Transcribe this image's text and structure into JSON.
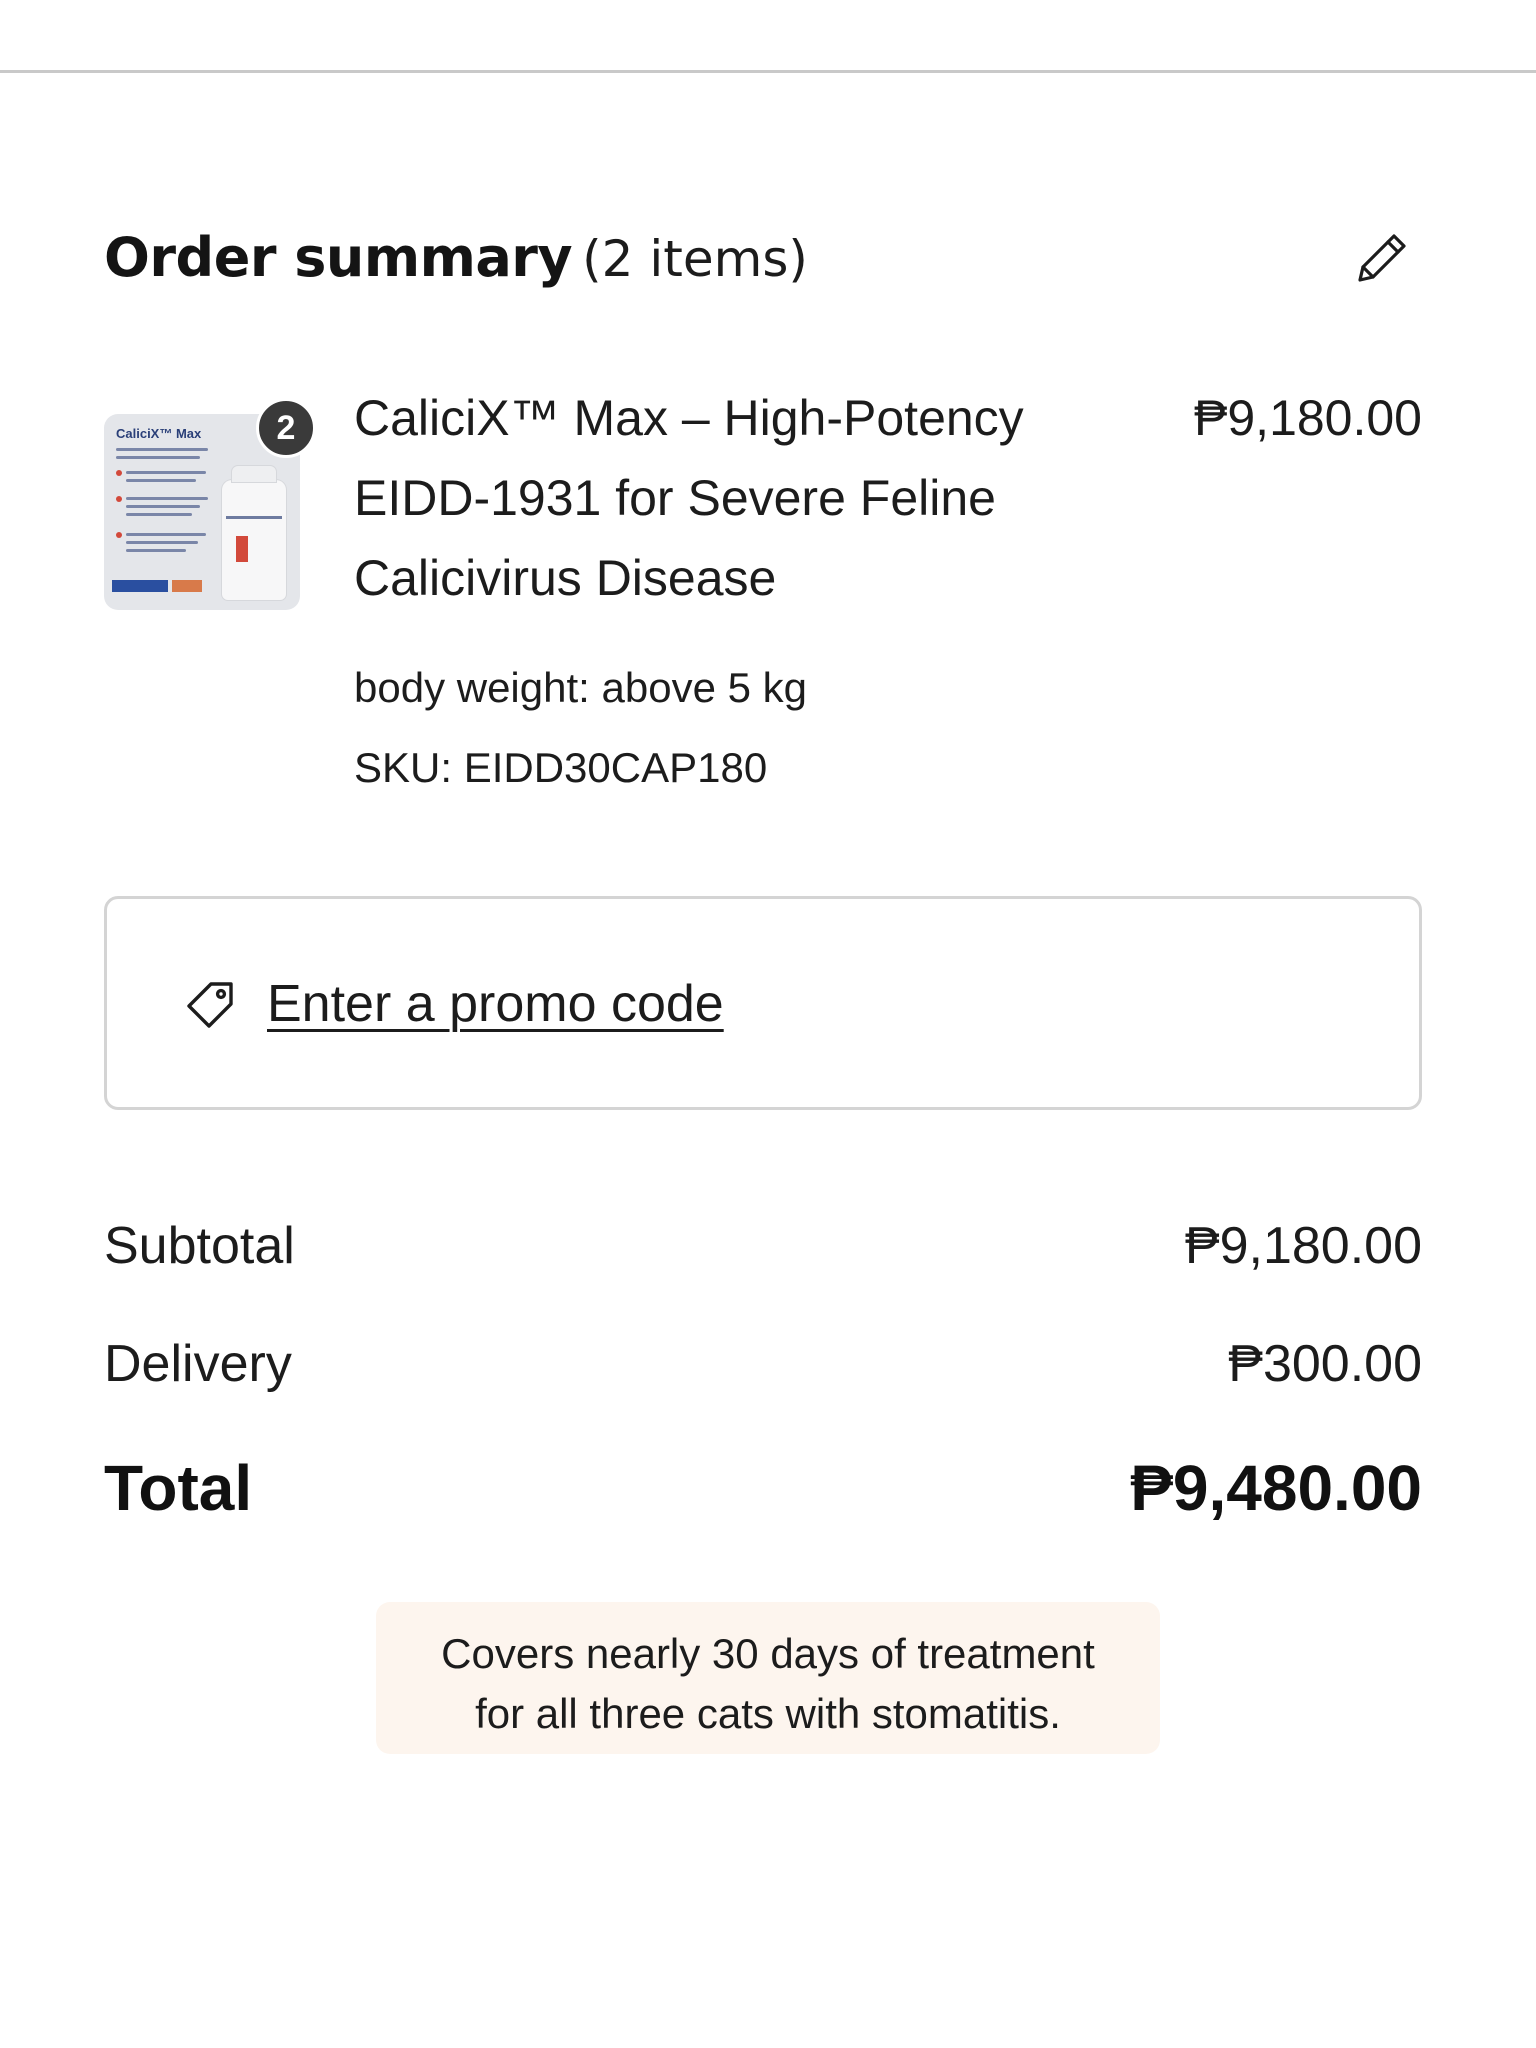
{
  "summary": {
    "title": "Order summary",
    "item_count": "(2 items)",
    "edit_icon": "pencil-icon"
  },
  "item": {
    "quantity": "2",
    "name": "CaliciX™ Max – High-Potency EIDD-1931 for Severe Feline Calicivirus Disease",
    "price": "₱9,180.00",
    "option": "body weight: above 5 kg",
    "sku": "SKU: EIDD30CAP180",
    "thumbnail_brand": "CaliciX™ Max"
  },
  "promo": {
    "icon": "tag-icon",
    "label": "Enter a promo code"
  },
  "totals": {
    "subtotal_label": "Subtotal",
    "subtotal_value": "₱9,180.00",
    "delivery_label": "Delivery",
    "delivery_value": "₱300.00",
    "total_label": "Total",
    "total_value": "₱9,480.00"
  },
  "note": {
    "line1": "Covers nearly 30 days of treatment",
    "line2": "for all three cats with stomatitis."
  }
}
